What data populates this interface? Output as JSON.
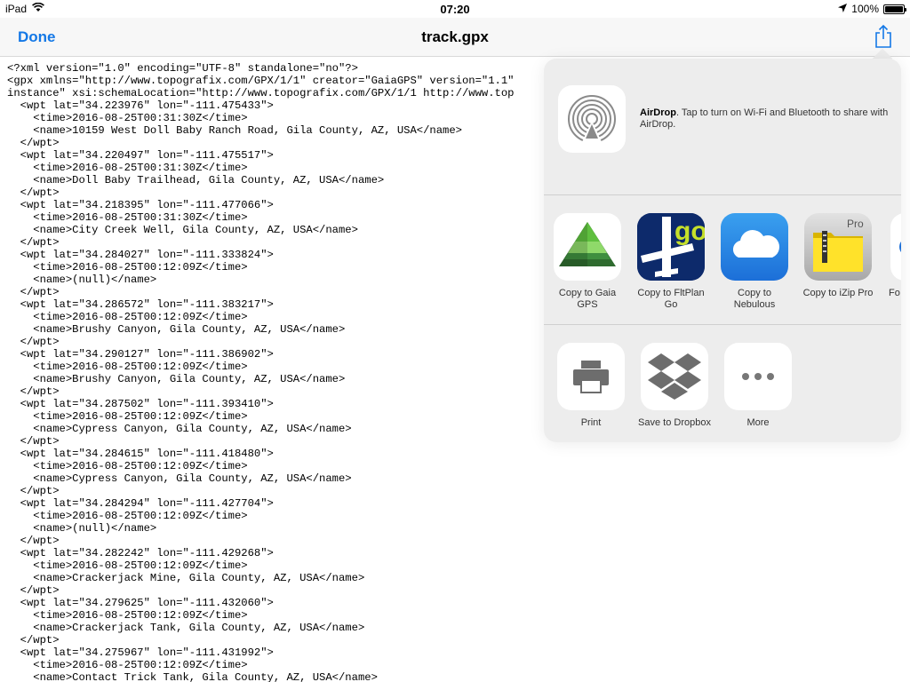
{
  "status_bar": {
    "device": "iPad",
    "time": "07:20",
    "battery": "100%",
    "battery_level": 1.0
  },
  "nav": {
    "done_label": "Done",
    "title": "track.gpx"
  },
  "document": {
    "lines": [
      "<?xml version=\"1.0\" encoding=\"UTF-8\" standalone=\"no\"?>",
      "<gpx xmlns=\"http://www.topografix.com/GPX/1/1\" creator=\"GaiaGPS\" version=\"1.1\"",
      "instance\" xsi:schemaLocation=\"http://www.topografix.com/GPX/1/1 http://www.top",
      "  <wpt lat=\"34.223976\" lon=\"-111.475433\">",
      "    <time>2016-08-25T00:31:30Z</time>",
      "    <name>10159 West Doll Baby Ranch Road, Gila County, AZ, USA</name>",
      "  </wpt>",
      "  <wpt lat=\"34.220497\" lon=\"-111.475517\">",
      "    <time>2016-08-25T00:31:30Z</time>",
      "    <name>Doll Baby Trailhead, Gila County, AZ, USA</name>",
      "  </wpt>",
      "  <wpt lat=\"34.218395\" lon=\"-111.477066\">",
      "    <time>2016-08-25T00:31:30Z</time>",
      "    <name>City Creek Well, Gila County, AZ, USA</name>",
      "  </wpt>",
      "  <wpt lat=\"34.284027\" lon=\"-111.333824\">",
      "    <time>2016-08-25T00:12:09Z</time>",
      "    <name>(null)</name>",
      "  </wpt>",
      "  <wpt lat=\"34.286572\" lon=\"-111.383217\">",
      "    <time>2016-08-25T00:12:09Z</time>",
      "    <name>Brushy Canyon, Gila County, AZ, USA</name>",
      "  </wpt>",
      "  <wpt lat=\"34.290127\" lon=\"-111.386902\">",
      "    <time>2016-08-25T00:12:09Z</time>",
      "    <name>Brushy Canyon, Gila County, AZ, USA</name>",
      "  </wpt>",
      "  <wpt lat=\"34.287502\" lon=\"-111.393410\">",
      "    <time>2016-08-25T00:12:09Z</time>",
      "    <name>Cypress Canyon, Gila County, AZ, USA</name>",
      "  </wpt>",
      "  <wpt lat=\"34.284615\" lon=\"-111.418480\">",
      "    <time>2016-08-25T00:12:09Z</time>",
      "    <name>Cypress Canyon, Gila County, AZ, USA</name>",
      "  </wpt>",
      "  <wpt lat=\"34.284294\" lon=\"-111.427704\">",
      "    <time>2016-08-25T00:12:09Z</time>",
      "    <name>(null)</name>",
      "  </wpt>",
      "  <wpt lat=\"34.282242\" lon=\"-111.429268\">",
      "    <time>2016-08-25T00:12:09Z</time>",
      "    <name>Crackerjack Mine, Gila County, AZ, USA</name>",
      "  </wpt>",
      "  <wpt lat=\"34.279625\" lon=\"-111.432060\">",
      "    <time>2016-08-25T00:12:09Z</time>",
      "    <name>Crackerjack Tank, Gila County, AZ, USA</name>",
      "  </wpt>",
      "  <wpt lat=\"34.275967\" lon=\"-111.431992\">",
      "    <time>2016-08-25T00:12:09Z</time>",
      "    <name>Contact Trick Tank, Gila County, AZ, USA</name>"
    ]
  },
  "share_sheet": {
    "airdrop": {
      "title": "AirDrop",
      "description": ". Tap to turn on Wi-Fi and Bluetooth to share with AirDrop."
    },
    "apps": [
      {
        "label": "Copy to Gaia\nGPS",
        "icon": "gaia-gps-icon"
      },
      {
        "label": "Copy to FltPlan\nGo",
        "icon": "fltplan-go-icon",
        "icon_text": "go"
      },
      {
        "label": "Copy to\nNebulous",
        "icon": "nebulous-icon"
      },
      {
        "label": "Copy to iZip Pro",
        "icon": "izip-pro-icon",
        "icon_text": "Pro"
      },
      {
        "label": "Fo",
        "icon": "partial-app-icon"
      }
    ],
    "actions": [
      {
        "label": "Print",
        "icon": "printer-icon"
      },
      {
        "label": "Save to Dropbox",
        "icon": "dropbox-icon"
      },
      {
        "label": "More",
        "icon": "more-icon"
      }
    ]
  },
  "colors": {
    "accent": "#1478e6",
    "sheet_bg": "#ececec"
  }
}
